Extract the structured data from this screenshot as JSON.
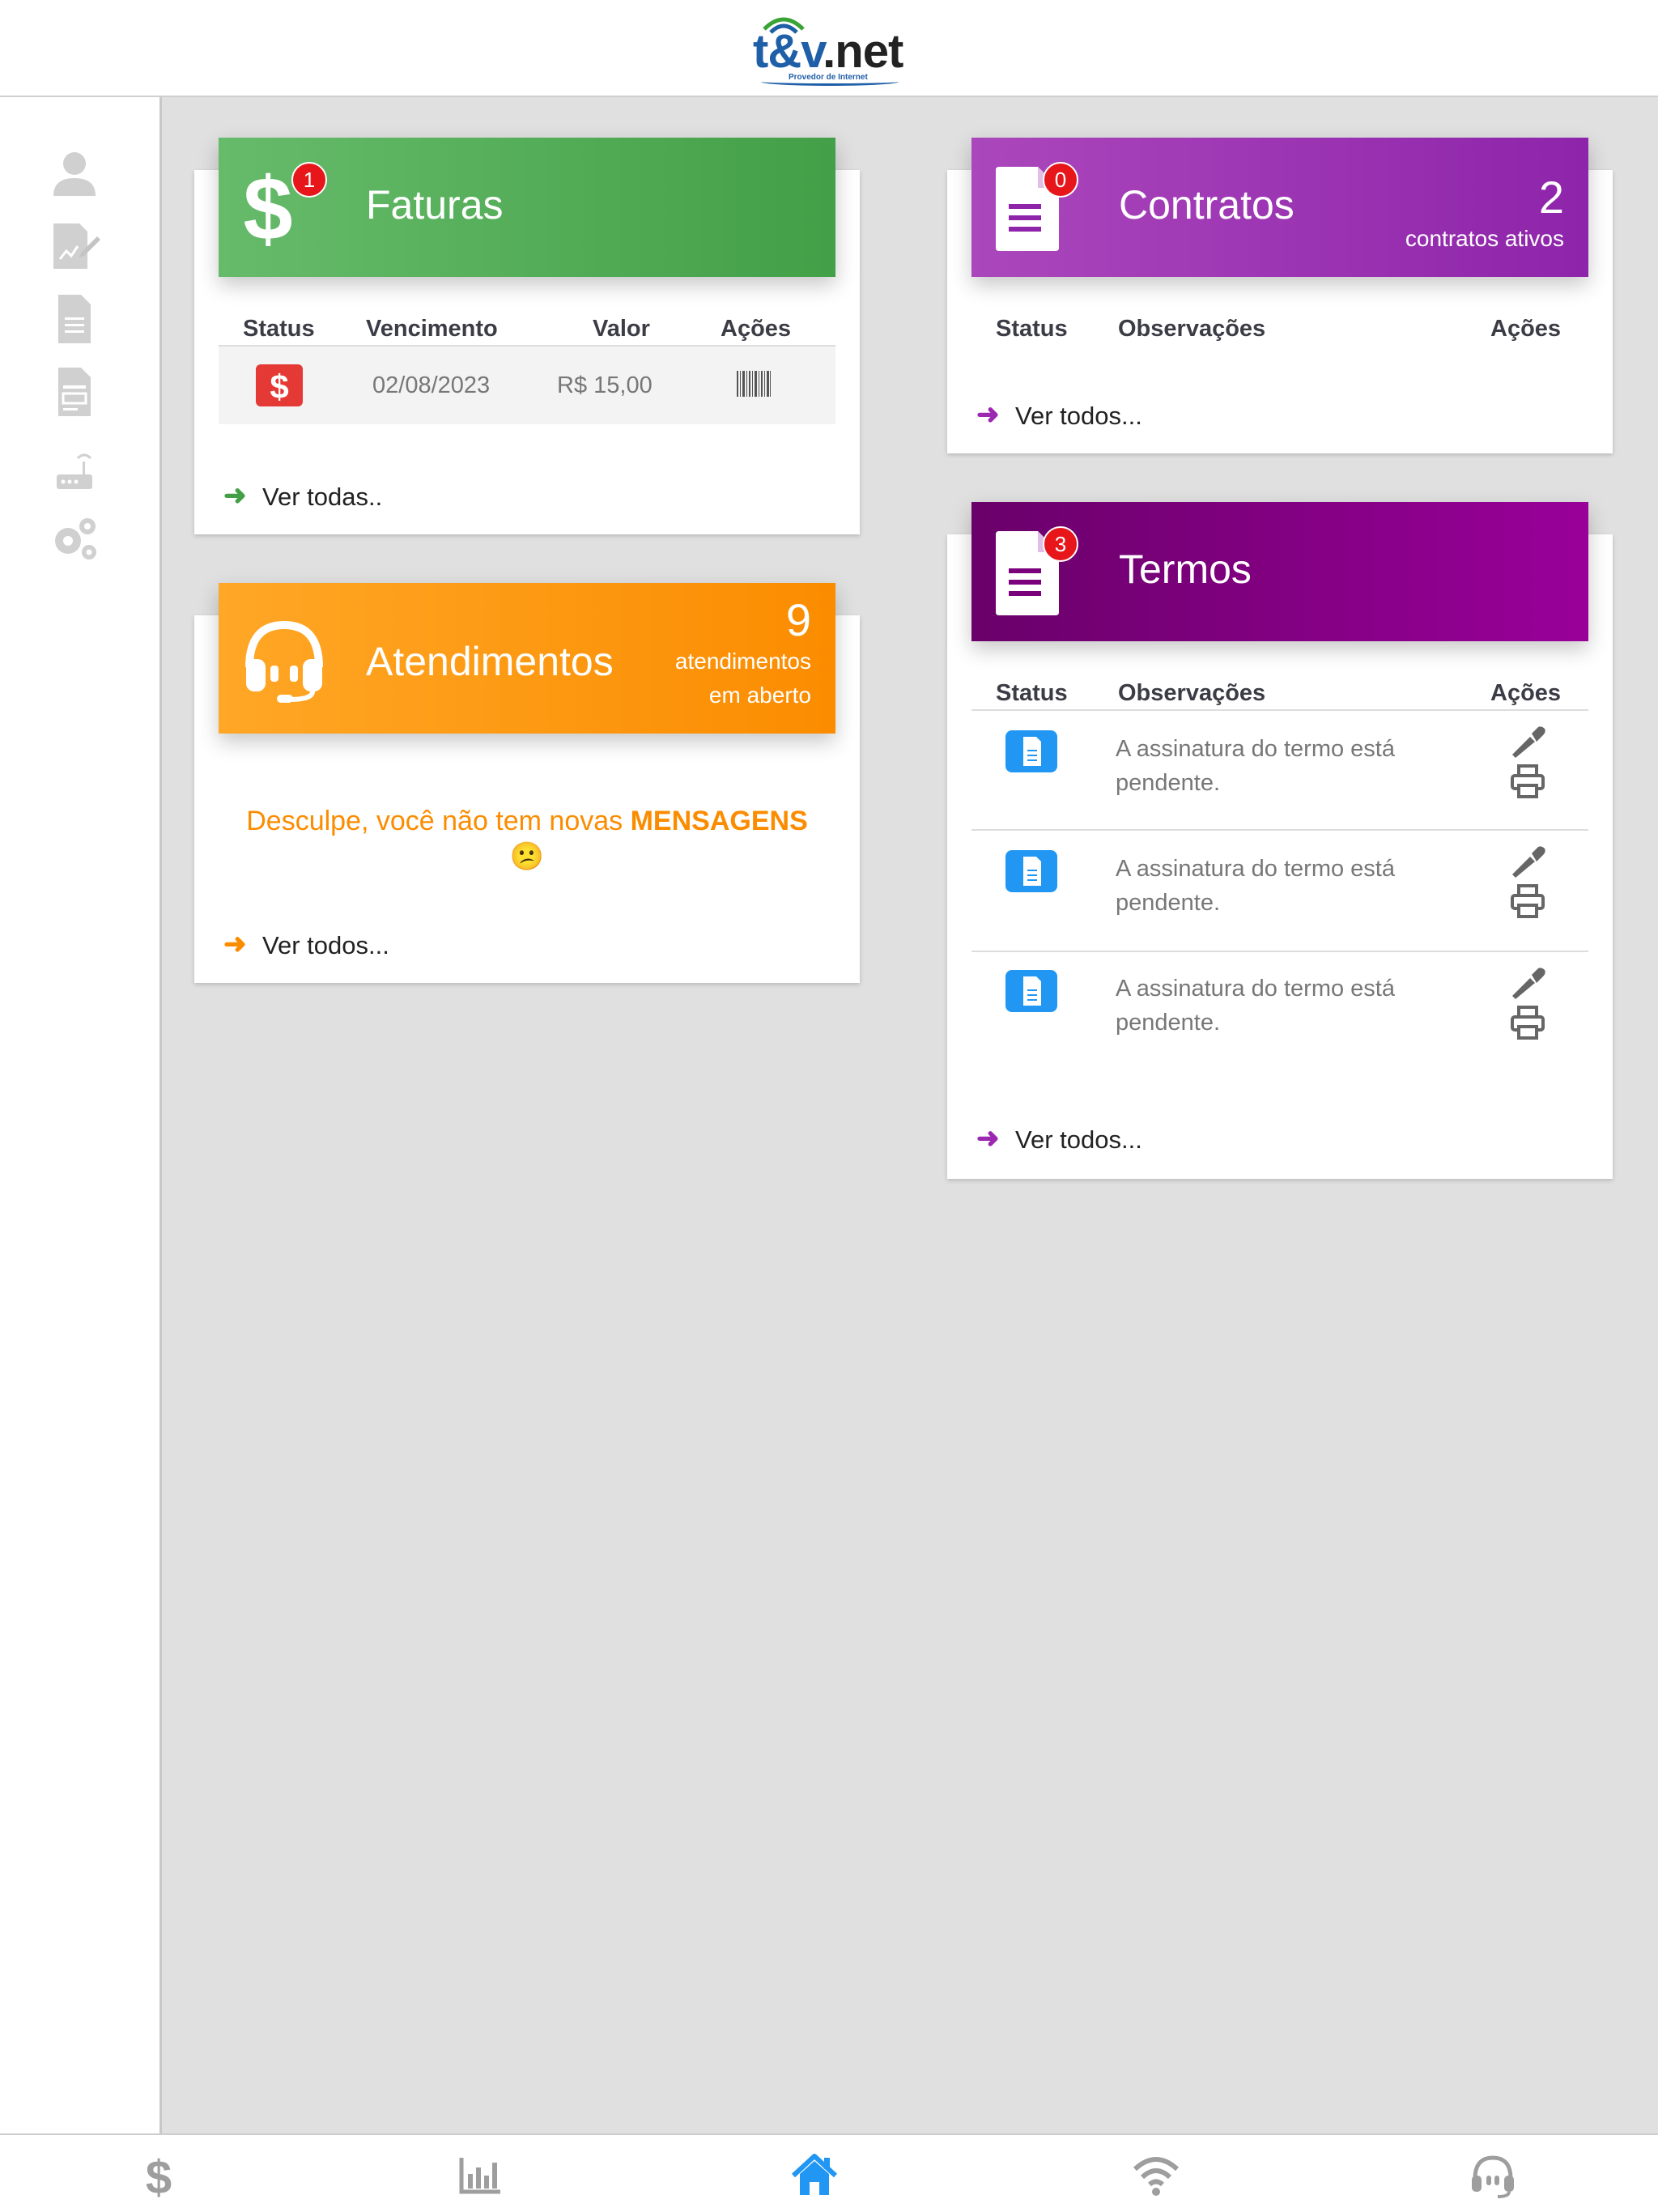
{
  "brand": {
    "logo_main": "t&v",
    "logo_dot": ".net",
    "logo_sub": "Provedor de Internet"
  },
  "sidebar": {
    "items": [
      {
        "icon": "user-icon"
      },
      {
        "icon": "signature-document-icon"
      },
      {
        "icon": "document-icon"
      },
      {
        "icon": "contract-document-icon"
      },
      {
        "icon": "router-icon"
      },
      {
        "icon": "settings-icon"
      }
    ]
  },
  "faturas": {
    "title": "Faturas",
    "badge": "1",
    "columns": [
      "Status",
      "Vencimento",
      "Valor",
      "Ações"
    ],
    "rows": [
      {
        "status_icon": "dollar-icon",
        "vencimento": "02/08/2023",
        "valor": "R$ 15,00",
        "action_icon": "barcode-icon"
      }
    ],
    "link": "Ver todas..",
    "color": "#4caf50"
  },
  "atendimentos": {
    "title": "Atendimentos",
    "count": "9",
    "sub1": "atendimentos",
    "sub2": "em aberto",
    "message_prefix": "Desculpe, você não tem novas ",
    "message_strong": "MENSAGENS",
    "emoji": "😕",
    "link": "Ver todos...",
    "color": "#ff9800"
  },
  "contratos": {
    "title": "Contratos",
    "badge": "0",
    "count": "2",
    "sub": "contratos ativos",
    "columns": [
      "Status",
      "Observações",
      "Ações"
    ],
    "link": "Ver todos...",
    "color": "#9c27b0"
  },
  "termos": {
    "title": "Termos",
    "badge": "3",
    "columns": [
      "Status",
      "Observações",
      "Ações"
    ],
    "rows": [
      {
        "line1": "A assinatura do termo está",
        "line2": "pendente."
      },
      {
        "line1": "A assinatura do termo está",
        "line2": "pendente."
      },
      {
        "line1": "A assinatura do termo está",
        "line2": "pendente."
      }
    ],
    "link": "Ver todos...",
    "color": "#8e008e"
  },
  "bottom_nav": [
    {
      "icon": "dollar-icon",
      "active": false
    },
    {
      "icon": "chart-icon",
      "active": false
    },
    {
      "icon": "home-icon",
      "active": true
    },
    {
      "icon": "wifi-icon",
      "active": false
    },
    {
      "icon": "headset-icon",
      "active": false
    }
  ]
}
